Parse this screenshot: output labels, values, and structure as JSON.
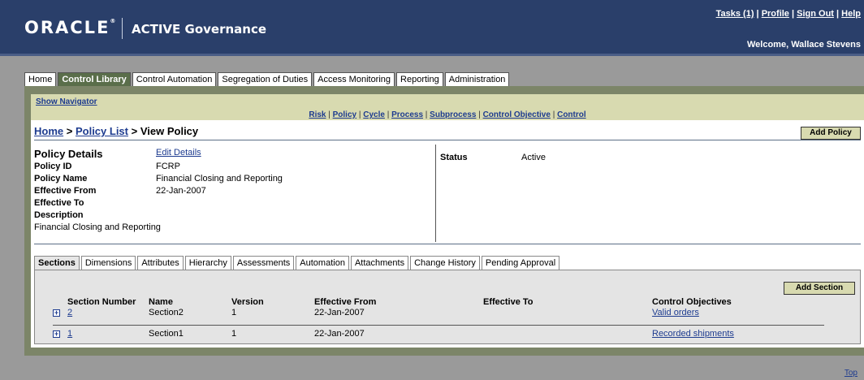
{
  "header": {
    "brand": "ORACLE",
    "brand_mark": "®",
    "product": "ACTIVE Governance",
    "links": [
      "Tasks (1)",
      "Profile",
      "Sign Out",
      "Help"
    ],
    "welcome": "Welcome, Wallace Stevens"
  },
  "main_tabs": [
    "Home",
    "Control Library",
    "Control Automation",
    "Segregation of Duties",
    "Access Monitoring",
    "Reporting",
    "Administration"
  ],
  "navigator": {
    "show_label": "Show Navigator",
    "links": [
      "Risk",
      "Policy",
      "Cycle",
      "Process",
      "Subprocess",
      "Control Objective",
      "Control"
    ]
  },
  "breadcrumb": {
    "home": "Home",
    "separator": ">",
    "list": "Policy List",
    "current": "View Policy"
  },
  "add_policy_label": "Add Policy",
  "details": {
    "title": "Policy Details",
    "edit_label": "Edit Details",
    "policy_id_label": "Policy ID",
    "policy_id": "FCRP",
    "policy_name_label": "Policy Name",
    "policy_name": "Financial Closing and Reporting",
    "effective_from_label": "Effective From",
    "effective_from": "22-Jan-2007",
    "effective_to_label": "Effective To",
    "effective_to": "",
    "description_label": "Description",
    "description": "Financial Closing and Reporting",
    "status_label": "Status",
    "status": "Active"
  },
  "sub_tabs": [
    "Sections",
    "Dimensions",
    "Attributes",
    "Hierarchy",
    "Assessments",
    "Automation",
    "Attachments",
    "Change History",
    "Pending Approval"
  ],
  "add_section_label": "Add Section",
  "sections": {
    "columns": [
      "Section Number",
      "Name",
      "Version",
      "Effective From",
      "Effective To",
      "Control Objectives"
    ],
    "rows": [
      {
        "number": "2",
        "name": "Section2",
        "version": "1",
        "effective_from": "22-Jan-2007",
        "effective_to": "",
        "objective": "Valid orders"
      },
      {
        "number": "1",
        "name": "Section1",
        "version": "1",
        "effective_from": "22-Jan-2007",
        "effective_to": "",
        "objective": "Recorded shipments"
      }
    ]
  },
  "top_link": "Top",
  "colors": {
    "header_bg": "#2a3f6a",
    "frame_bg": "#7c8568",
    "nav_bg": "#d8dab0",
    "active_tab": "#5a6e4a",
    "link": "#1d3b8f"
  }
}
